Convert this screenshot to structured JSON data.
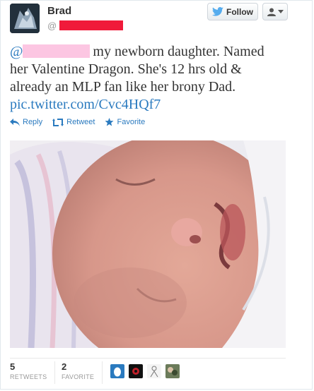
{
  "header": {
    "name": "Brad",
    "handle_prefix": "@",
    "follow_label": "Follow"
  },
  "tweet": {
    "mention_prefix": "@",
    "text_line1": "my newborn daughter. Named",
    "text_line2": "her Valentine Dragon. She's 12 hrs old &",
    "text_line3": "already an MLP fan like her brony Dad.",
    "link": "pic.twitter.com/Cvc4HQf7"
  },
  "actions": {
    "reply": "Reply",
    "retweet": "Retweet",
    "favorite": "Favorite"
  },
  "stats": {
    "retweets_count": "5",
    "retweets_label": "RETWEETS",
    "favorites_count": "2",
    "favorites_label": "FAVORITE"
  },
  "colors": {
    "link": "#2a7abf",
    "redaction_red": "#f01a3a",
    "redaction_pink": "#fcc6e2"
  }
}
